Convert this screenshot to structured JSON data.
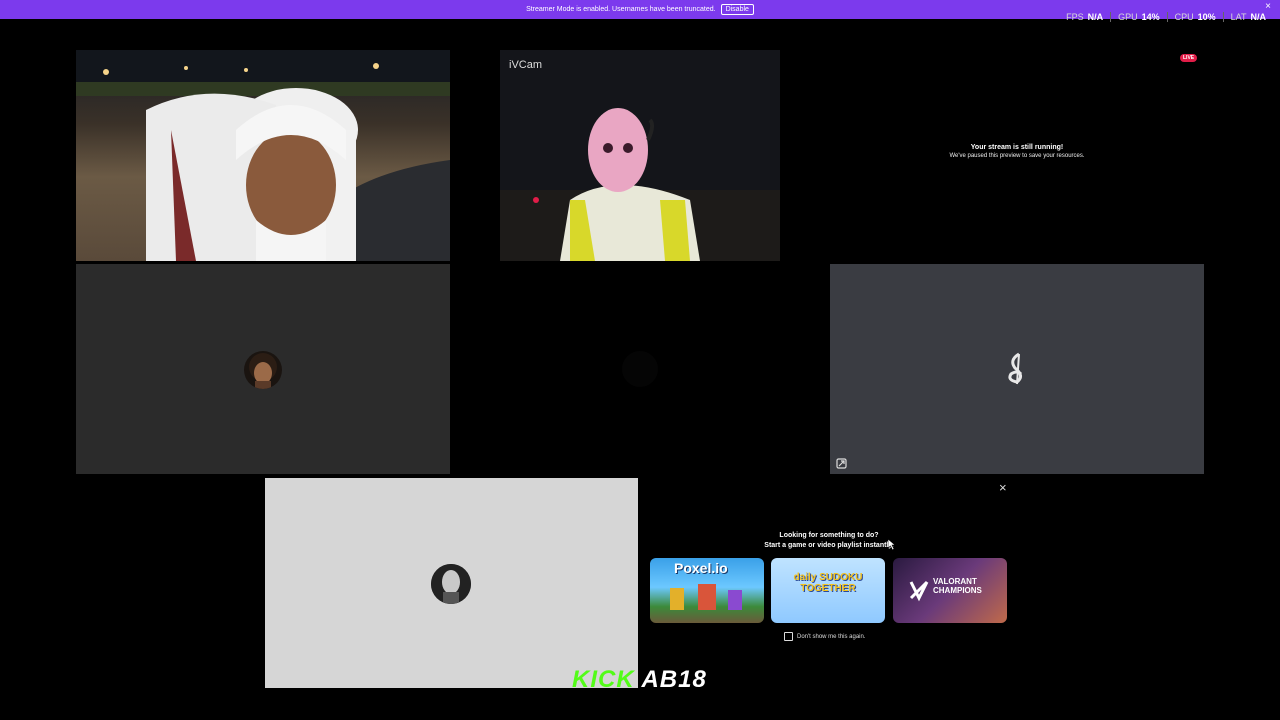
{
  "banner": {
    "message": "Streamer Mode is enabled. Usernames have been truncated.",
    "button": "Disable",
    "close": "×"
  },
  "stats": [
    {
      "label": "FPS",
      "value": "N/A"
    },
    {
      "label": "GPU",
      "value": "14%"
    },
    {
      "label": "CPU",
      "value": "10%"
    },
    {
      "label": "LAT",
      "value": "N/A"
    }
  ],
  "tiles": {
    "cam2_label": "iVCam",
    "live_badge": "LIVE",
    "paused_title": "Your stream is still running!",
    "paused_sub": "We've paused this preview to save your resources."
  },
  "activity": {
    "close": "×",
    "heading_line1": "Looking for something to do?",
    "heading_line2": "Start a game or video playlist instantly.",
    "cards": [
      {
        "name": "Poxel.io"
      },
      {
        "name": "daily SUDOKU TOGETHER"
      },
      {
        "name": "VALORANT CHAMPIONS"
      }
    ],
    "dont_show": "Don't show me this again."
  },
  "overlay": {
    "kick_text": "KICK",
    "handle_text": "AB18"
  },
  "colors": {
    "banner": "#7c3aed",
    "tile_dark": "#2b2b2b",
    "tile_slate": "#3a3c42",
    "tile_light": "#d6d6d6",
    "kick_green": "#53fc18",
    "live_red": "#e11d48"
  }
}
